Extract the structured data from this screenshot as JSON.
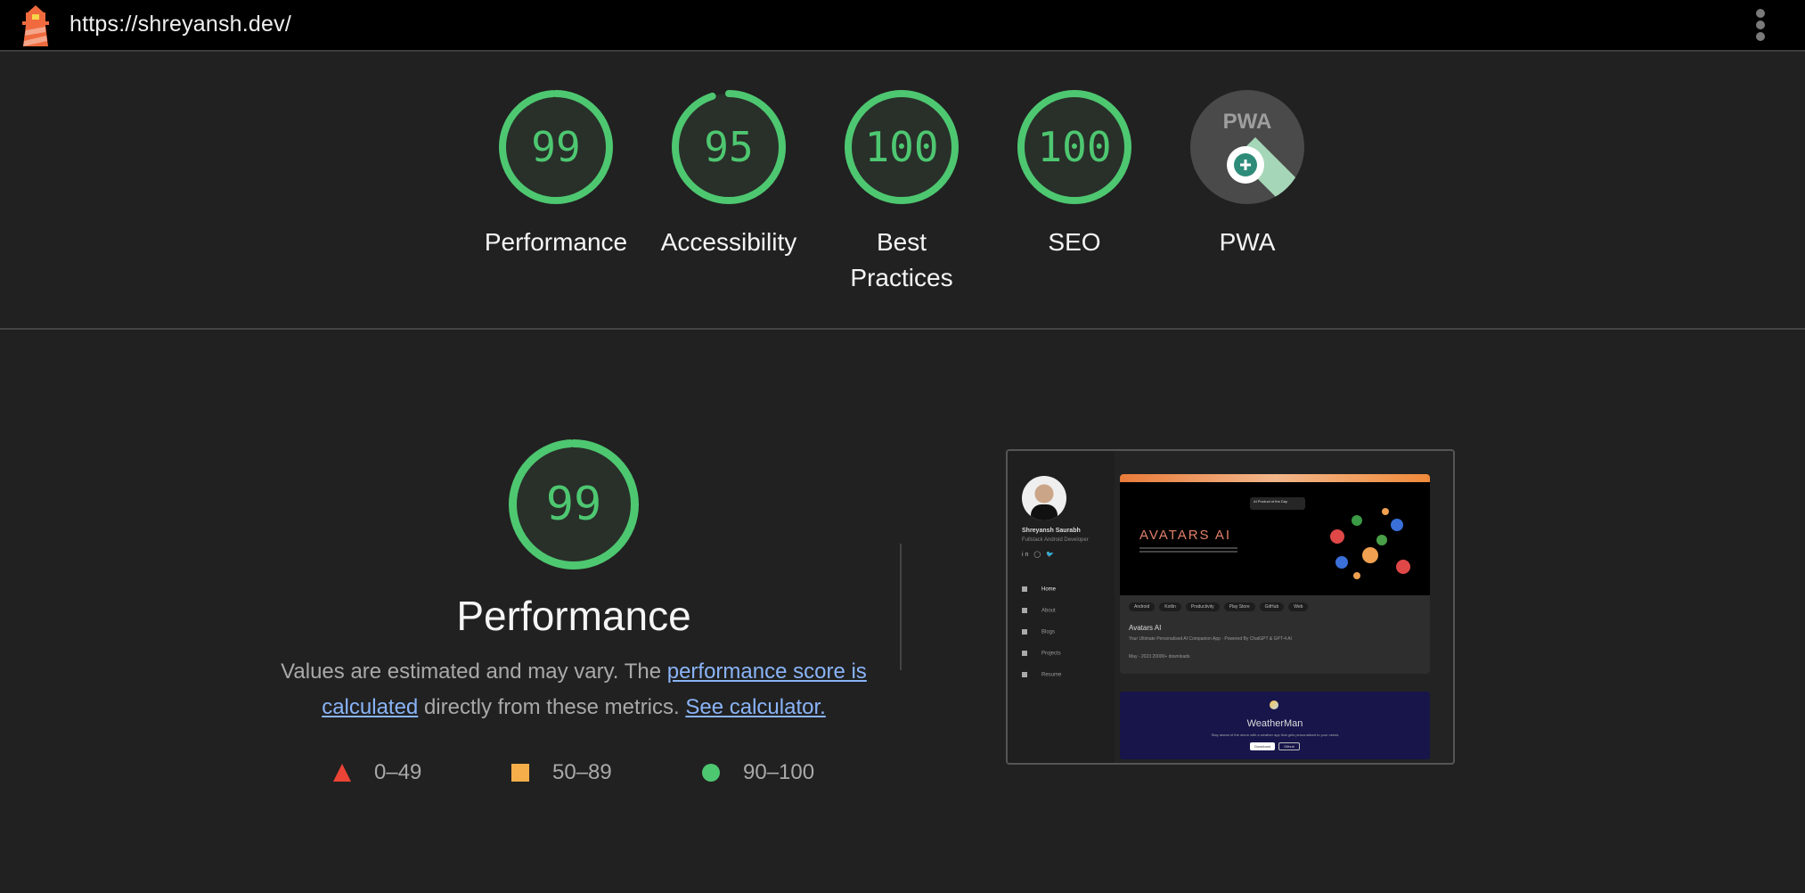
{
  "topbar": {
    "url": "https://shreyansh.dev/",
    "logo_icon": "lighthouse-icon",
    "menu_icon": "more-vert-icon"
  },
  "colors": {
    "pass": "#4ec771",
    "average": "#f6ae4a",
    "fail": "#eb4335",
    "link": "#8ab4f8",
    "background": "#212121"
  },
  "categories": [
    {
      "id": "performance",
      "label": "Performance",
      "score": 99
    },
    {
      "id": "accessibility",
      "label": "Accessibility",
      "score": 95
    },
    {
      "id": "best-practices",
      "label": "Best Practices",
      "score": 100
    },
    {
      "id": "seo",
      "label": "SEO",
      "score": 100
    },
    {
      "id": "pwa",
      "label": "PWA",
      "badge_text": "PWA",
      "icon": "pwa-badge-icon"
    }
  ],
  "performance": {
    "score": 99,
    "title": "Performance",
    "desc_prefix": "Values are estimated and may vary. The ",
    "link1": "performance score is calculated",
    "desc_middle": " directly from these metrics. ",
    "link2": "See calculator."
  },
  "legend": [
    {
      "shape": "triangle",
      "range": "0–49"
    },
    {
      "shape": "square",
      "range": "50–89"
    },
    {
      "shape": "circle",
      "range": "90–100"
    }
  ],
  "screenshot": {
    "profile_name": "Shreyansh Saurabh",
    "profile_role": "Fullstack Android Developer",
    "social": "in ◯ 🐦",
    "nav": [
      "Home",
      "About",
      "Blogs",
      "Projects",
      "Resume"
    ],
    "banner_pill": "AI Product of the Day",
    "hero_brand": "AVATARS AI",
    "chips": [
      "Android",
      "Kotlin",
      "Productivity",
      "Play Store",
      "GitHub",
      "Web"
    ],
    "card_title": "Avatars AI",
    "card_desc": "Your Ultimate Personalised AI Companion App · Powered By ChatGPT & GPT-4 AI",
    "card_meta": "May - 2023      20000+ downloads",
    "weather_title": "WeatherMan",
    "weather_desc": "Stay ahead of the storm with a weather app that gets personalised to your needs",
    "weather_btn1": "Download",
    "weather_btn2": "Github"
  }
}
